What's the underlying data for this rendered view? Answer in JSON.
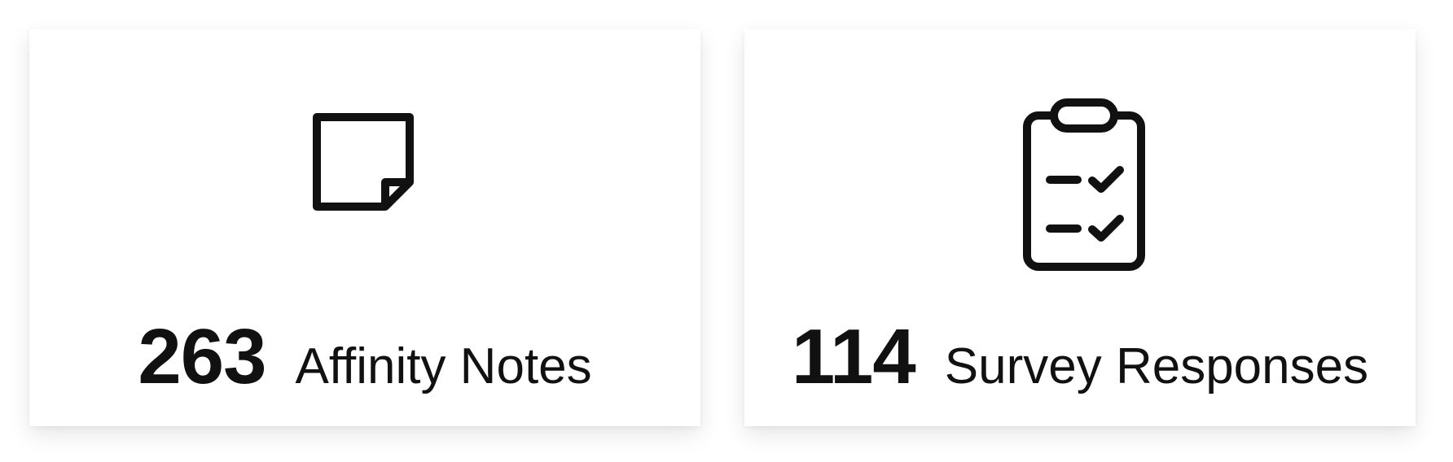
{
  "cards": [
    {
      "count": "263",
      "label": "Affinity Notes",
      "icon": "sticky-note-icon"
    },
    {
      "count": "114",
      "label": "Survey Responses",
      "icon": "clipboard-checklist-icon"
    }
  ],
  "colors": {
    "background": "#ffffff",
    "card": "#ffffff",
    "text": "#111111",
    "icon": "#111111"
  }
}
